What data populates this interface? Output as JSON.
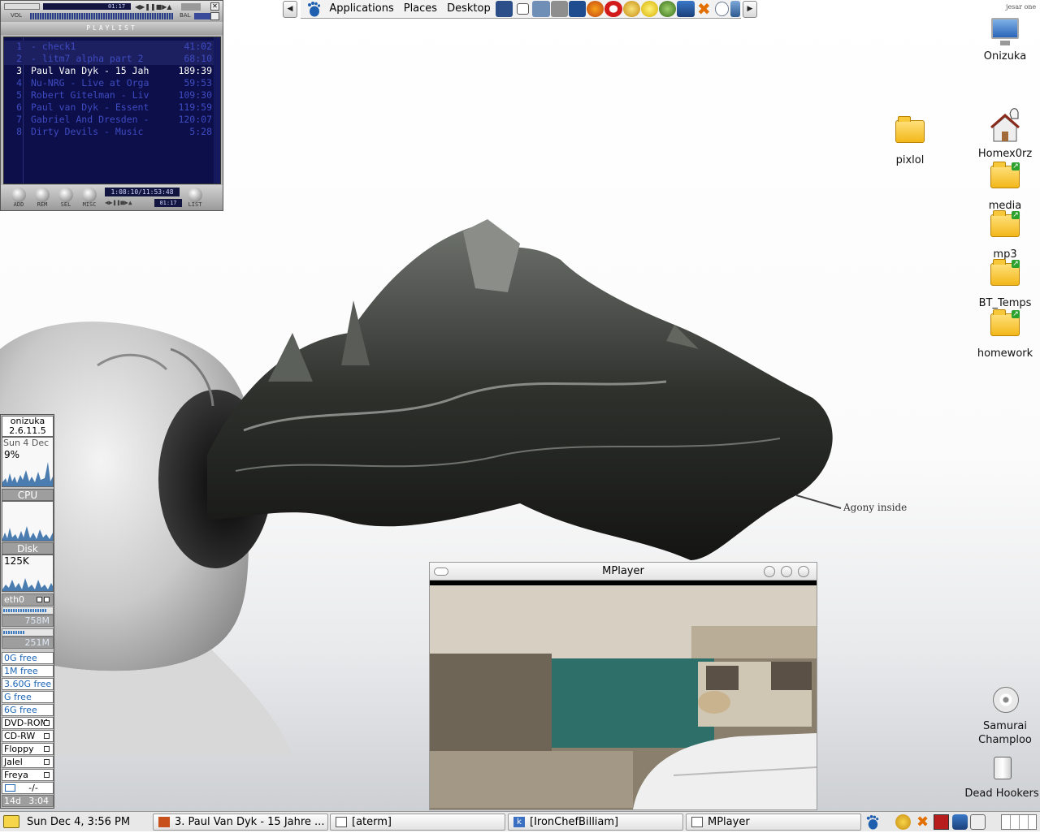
{
  "desktop": {
    "wallpaper_caption": "Agony inside",
    "user_tag": "jesar one",
    "icons": [
      {
        "label": "Onizuka",
        "kind": "computer"
      },
      {
        "label": "pixlol",
        "kind": "folder"
      },
      {
        "label": "Homex0rz",
        "kind": "home"
      },
      {
        "label": "media",
        "kind": "folder-link"
      },
      {
        "label": "mp3",
        "kind": "folder-link"
      },
      {
        "label": "BT_Temps",
        "kind": "folder-link"
      },
      {
        "label": "homework",
        "kind": "folder-link"
      },
      {
        "label": "Samurai Champloo",
        "kind": "cdrom"
      },
      {
        "label": "Dead Hookers",
        "kind": "trash"
      }
    ]
  },
  "top_panel": {
    "menus": [
      "Applications",
      "Places",
      "Desktop"
    ],
    "launchers": [
      "terminal-icon",
      "window-icon",
      "home-folder-icon",
      "gamepad-icon",
      "display-icon",
      "firefox-icon",
      "opera-icon",
      "gaim-icon",
      "smiley-icon",
      "music-icon",
      "thunderbird-icon",
      "cross-tool-icon",
      "clock-icon",
      "pda-icon"
    ]
  },
  "xmms": {
    "title": "PLAYLIST",
    "time_display": "1:08:10/11:53:48",
    "mini_time": "01:17",
    "top_time": "01:17",
    "vol_label": "VOL",
    "bal_label": "BAL",
    "buttons": [
      "ADD",
      "REM",
      "SEL",
      "MISC",
      "LIST"
    ],
    "playlist": [
      {
        "num": "1",
        "title": " - check1",
        "time": "41:02",
        "state": "selected"
      },
      {
        "num": "2",
        "title": " - litm7 alpha part 2",
        "time": "68:10",
        "state": "selected"
      },
      {
        "num": "3",
        "title": "Paul Van Dyk - 15 Jah",
        "time": "189:39",
        "state": "current"
      },
      {
        "num": "4",
        "title": "Nu-NRG - Live at Orga",
        "time": "59:53",
        "state": "normal"
      },
      {
        "num": "5",
        "title": "Robert Gitelman - Liv",
        "time": "109:30",
        "state": "normal"
      },
      {
        "num": "6",
        "title": "Paul van Dyk - Essent",
        "time": "119:59",
        "state": "normal"
      },
      {
        "num": "7",
        "title": "Gabriel And Dresden -",
        "time": "120:07",
        "state": "normal"
      },
      {
        "num": "8",
        "title": "Dirty Devils - Music ",
        "time": "5:28",
        "state": "normal"
      }
    ]
  },
  "monitor": {
    "host": "onizuka",
    "kernel": "2.6.11.5",
    "date": "Sun  4 Dec",
    "cpu_percent": "9%",
    "cpu_label": "CPU",
    "disk_label": "Disk",
    "disk_rate": "125K",
    "net_label": "eth0",
    "mem_used": "758M",
    "swap_used": "251M",
    "mem_fraction": 0.88,
    "swap_fraction": 0.45,
    "filesystems": [
      "0G free",
      "1M free",
      "3.60G free",
      "G free",
      "6G free"
    ],
    "mounts": [
      "DVD-ROM",
      "CD-RW",
      "Floppy",
      "Jalel",
      "Freya"
    ],
    "uptime_left": "14d",
    "uptime_right": "3:04",
    "mail": "-/-"
  },
  "mplayer": {
    "title": "MPlayer"
  },
  "taskbar": {
    "clock": "Sun Dec  4,  3:56 PM",
    "tasks": [
      {
        "label": "3. Paul Van Dyk - 15 Jahre ...",
        "icon": "xmms-icon"
      },
      {
        "label": "[aterm]",
        "icon": "window-icon"
      },
      {
        "label": "[IronChefBilliam]",
        "icon": "konqueror-icon"
      },
      {
        "label": "MPlayer",
        "icon": "window-icon"
      }
    ]
  }
}
